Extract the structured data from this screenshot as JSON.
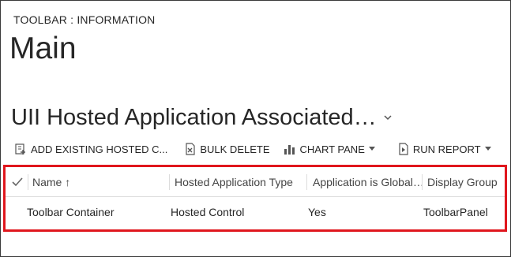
{
  "header": {
    "entity_label": "TOOLBAR : INFORMATION",
    "form_title": "Main"
  },
  "view": {
    "title": "UII Hosted Application Associated…",
    "chevron_icon": "chevron-down-icon"
  },
  "toolbar": {
    "add_existing": "ADD EXISTING HOSTED C...",
    "bulk_delete": "BULK DELETE",
    "chart_pane": "CHART PANE",
    "run_report": "RUN REPORT",
    "icons": [
      "add-existing-icon",
      "bulk-delete-icon",
      "chart-icon",
      "report-icon",
      "excel-icon"
    ]
  },
  "grid": {
    "columns": [
      "Name ↑",
      "Hosted Application Type",
      "Application is Global…",
      "Display Group"
    ],
    "rows": [
      [
        "Toolbar Container",
        "Hosted Control",
        "Yes",
        "ToolbarPanel"
      ]
    ]
  },
  "colors": {
    "highlight_border": "#e0161d",
    "text": "#262626"
  }
}
